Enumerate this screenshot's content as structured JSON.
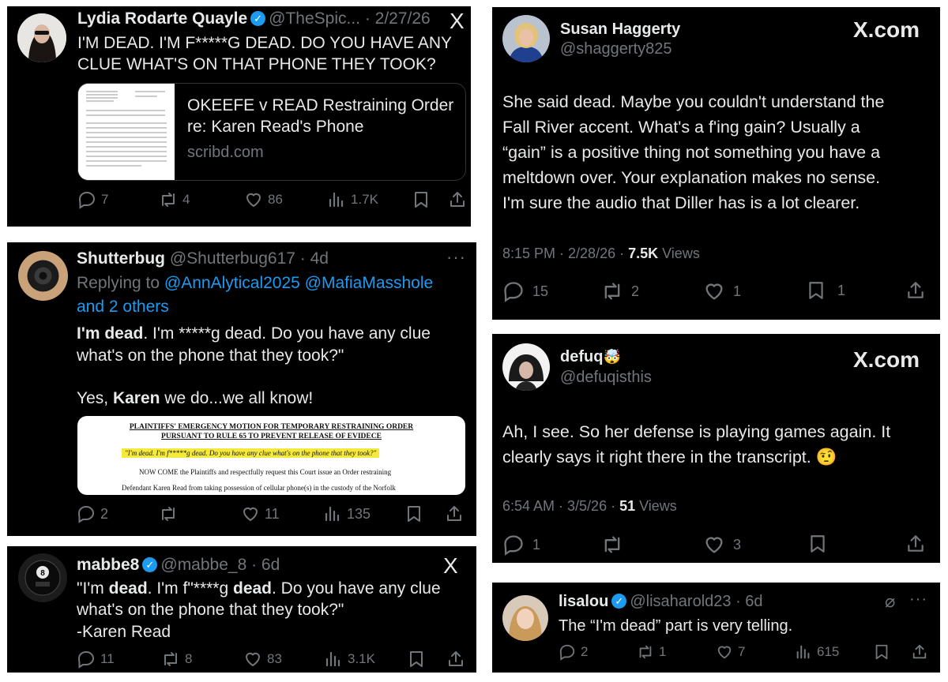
{
  "tweet1": {
    "name": "Lydia Rodarte Quayle",
    "handle_time": "@TheSpic... · 2/27/26",
    "text_line1": "I'M DEAD. I'M F*****G DEAD. DO YOU HAVE ANY",
    "text_line2": "CLUE WHAT'S ON THAT PHONE THEY TOOK?",
    "card_title_line1": "OKEEFE v READ Restraining Order",
    "card_title_line2": "re: Karen Read's Phone",
    "card_domain": "scribd.com",
    "replies": "7",
    "reposts": "4",
    "likes": "86",
    "views": "1.7K",
    "logo": "X"
  },
  "tweet2": {
    "name": "Shutterbug",
    "handle_time": "@Shutterbug617 · 4d",
    "replying_prefix": "Replying to",
    "replying_targets": "@AnnAlytical2025 @MafiaMasshole",
    "replying_more": "and 2 others",
    "quote_bold1": "I'm dead",
    "quote_rest1": ". I'm *****g dead. Do you have any clue",
    "quote_line2": "what's on the phone that they took?\"",
    "reply_prefix": "Yes, ",
    "reply_bold": "Karen",
    "reply_suffix": " we do...we all know!",
    "doc_heading1": "PLAINTIFFS' EMERGENCY MOTION FOR TEMPORARY RESTRAINING ORDER",
    "doc_heading2": "PURSUANT TO RULE 65 TO PREVENT RELEASE OF EVIDECE",
    "doc_highlight": "\"I'm dead. I'm f*****g dead. Do you have any clue what's on the phone that they took?\"",
    "doc_body1": "NOW COME the Plaintiffs and respectfully request this Court issue an Order restraining",
    "doc_body2": "Defendant Karen Read from taking possession of cellular phone(s) in the custody of the Norfolk",
    "replies": "2",
    "reposts": "",
    "likes": "11",
    "views": "135"
  },
  "tweet3": {
    "name": "mabbe8",
    "handle_time": "@mabbe_8 · 6d",
    "l1_a": "\"I'm ",
    "l1_b": "dead",
    "l1_c": ". I'm f\"****g ",
    "l1_d": "dead",
    "l1_e": ". Do you have any clue",
    "line2": "what's on the phone that they took?\"",
    "line3": "-Karen Read",
    "replies": "11",
    "reposts": "8",
    "likes": "83",
    "views": "3.1K",
    "logo": "X"
  },
  "tweet4": {
    "name": "Susan Haggerty",
    "handle": "@shaggerty825",
    "site": "X.com",
    "lines": [
      "She said dead. Maybe you couldn't understand the",
      "Fall River accent. What's a f'ing gain?  Usually a",
      "“gain” is a positive thing not something you have a",
      "meltdown over. Your explanation makes no sense.",
      "I'm sure the audio that Diller has is a lot clearer."
    ],
    "meta_time": "8:15 PM · 2/28/26 · ",
    "meta_views": "7.5K",
    "meta_views_label": " Views",
    "replies": "15",
    "reposts": "2",
    "likes": "1",
    "bookmarks": "1"
  },
  "tweet5": {
    "name": "defuq",
    "name_emoji": "🤯",
    "handle": "@defuqisthis",
    "site": "X.com",
    "line1": "Ah, I see. So her defense is playing games again. It",
    "line2": "clearly says it right there in the transcript. ",
    "emoji": "🤨",
    "meta_time": "6:54 AM · 3/5/26 · ",
    "meta_views": "51",
    "meta_views_label": " Views",
    "replies": "1",
    "reposts": "",
    "likes": "3"
  },
  "tweet6": {
    "name": "lisalou",
    "handle_time": "@lisaharold23 · 6d",
    "text": "The “I'm dead” part is very telling.",
    "replies": "2",
    "reposts": "1",
    "likes": "7",
    "views": "615"
  },
  "colors": {
    "background": "#000000",
    "text": "#e7e9ea",
    "muted": "#71767b",
    "link": "#1d9bf0",
    "highlight": "#f5ea3c"
  },
  "icons": [
    "reply-icon",
    "repost-icon",
    "like-icon",
    "views-icon",
    "bookmark-icon",
    "share-icon",
    "verified-badge-icon",
    "x-logo-icon",
    "more-dots-icon",
    "grok-icon"
  ]
}
